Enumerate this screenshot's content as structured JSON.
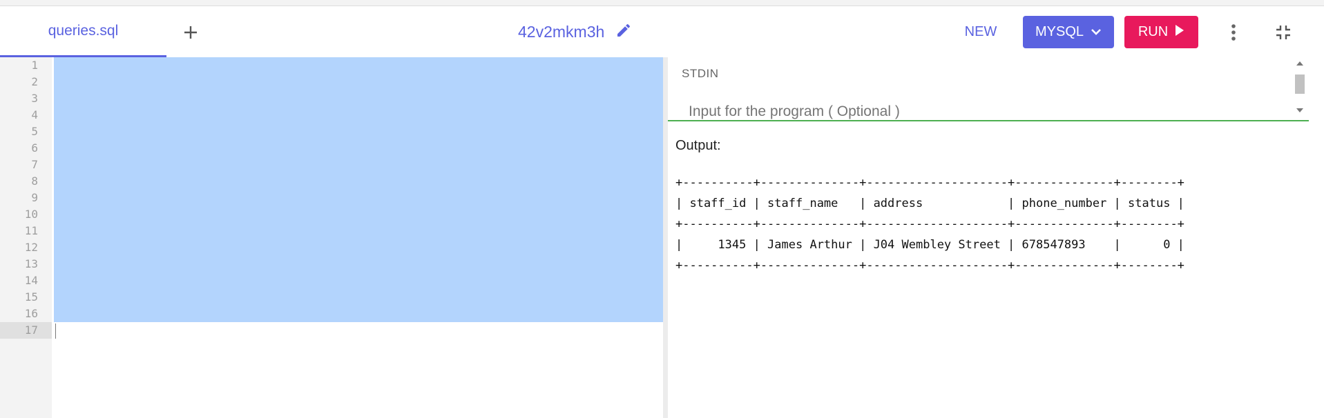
{
  "header": {
    "file_tab": "queries.sql",
    "add_tab_icon": "plus-icon",
    "session_name": "42v2mkm3h",
    "edit_icon": "pencil-icon",
    "new_label": "NEW",
    "language_label": "MYSQL",
    "run_label": "RUN",
    "more_icon": "vertical-dots-icon",
    "collapse_icon": "collapse-icon"
  },
  "editor": {
    "line_numbers": [
      "1",
      "2",
      "3",
      "4",
      "5",
      "6",
      "7",
      "8",
      "9",
      "10",
      "11",
      "12",
      "13",
      "14",
      "15",
      "16",
      "17"
    ],
    "active_line": 17
  },
  "stdin": {
    "label": "STDIN",
    "placeholder": "Input for the program ( Optional )"
  },
  "output": {
    "label": "Output:",
    "lines": [
      "+----------+--------------+--------------------+--------------+--------+",
      "| staff_id | staff_name   | address            | phone_number | status |",
      "+----------+--------------+--------------------+--------------+--------+",
      "|     1345 | James Arthur | J04 Wembley Street | 678547893    |      0 |",
      "+----------+--------------+--------------------+--------------+--------+"
    ]
  },
  "colors": {
    "accent": "#5a62e0",
    "run": "#e8195c",
    "selection": "#b3d4fd",
    "number": "#11999e",
    "string": "#d01858",
    "stdin_line": "#4caf50"
  }
}
